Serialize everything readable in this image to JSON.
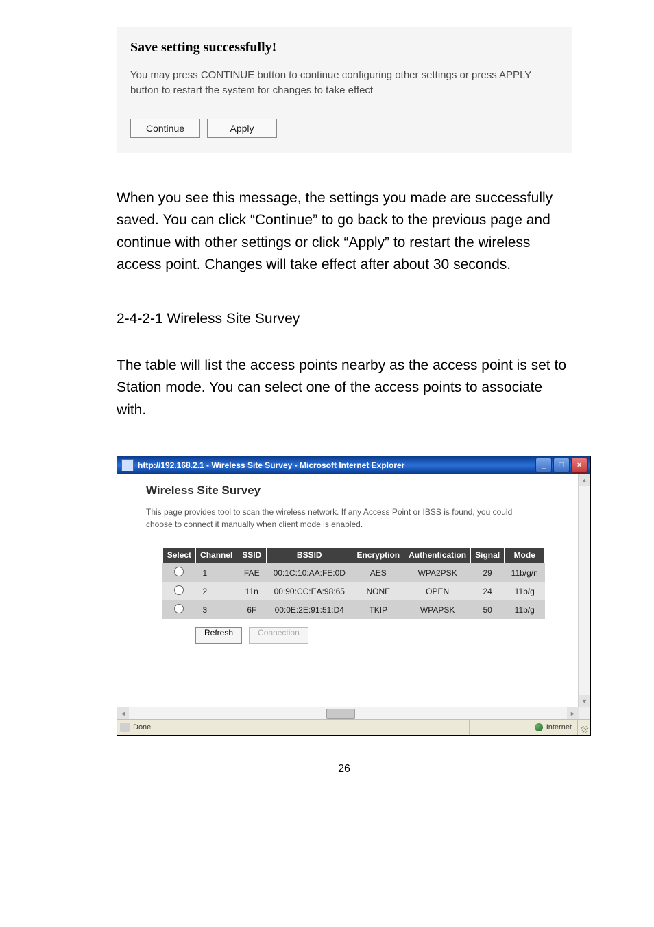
{
  "save_panel": {
    "title": "Save setting successfully!",
    "desc": "You may press CONTINUE button to continue configuring other settings or press APPLY button to restart the system for changes to take effect",
    "continue_label": "Continue",
    "apply_label": "Apply"
  },
  "body_text": "When you see this message, the settings you made are successfully saved. You can click “Continue” to go back to the previous page and continue with other settings or click “Apply” to restart the wireless access point. Changes will take effect after about 30 seconds.",
  "section_heading": "2-4-2-1 Wireless Site Survey",
  "section_body": "The table will list the access points nearby as the access point is set to Station mode. You can select one of the access points to associate with.",
  "browser": {
    "title": "http://192.168.2.1 - Wireless Site Survey - Microsoft Internet Explorer",
    "minimize": "_",
    "maximize": "□",
    "close": "×",
    "status_left": "Done",
    "status_zone": "Internet"
  },
  "survey": {
    "title": "Wireless Site Survey",
    "desc": "This page provides tool to scan the wireless network. If any Access Point or IBSS is found, you could choose to connect it manually when client mode is enabled.",
    "headers": [
      "Select",
      "Channel",
      "SSID",
      "BSSID",
      "Encryption",
      "Authentication",
      "Signal",
      "Mode"
    ],
    "rows": [
      {
        "channel": "1",
        "ssid": "FAE",
        "bssid": "00:1C:10:AA:FE:0D",
        "encryption": "AES",
        "authentication": "WPA2PSK",
        "signal": "29",
        "mode": "11b/g/n"
      },
      {
        "channel": "2",
        "ssid": "11n",
        "bssid": "00:90:CC:EA:98:65",
        "encryption": "NONE",
        "authentication": "OPEN",
        "signal": "24",
        "mode": "11b/g"
      },
      {
        "channel": "3",
        "ssid": "6F",
        "bssid": "00:0E:2E:91:51:D4",
        "encryption": "TKIP",
        "authentication": "WPAPSK",
        "signal": "50",
        "mode": "11b/g"
      }
    ],
    "refresh_label": "Refresh",
    "connection_label": "Connection"
  },
  "page_number": "26"
}
